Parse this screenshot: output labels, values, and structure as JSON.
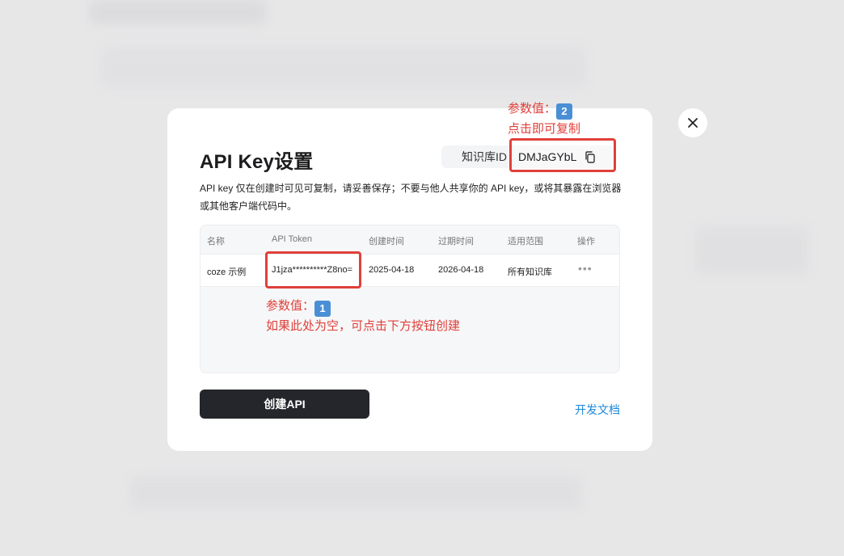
{
  "modal": {
    "title": "API Key设置",
    "knowledge_base": {
      "label": "知识库ID",
      "value": "DMJaGYbL"
    },
    "description": "API key 仅在创建时可见可复制，请妥善保存；不要与他人共享你的 API key，或将其暴露在浏览器或其他客户端代码中。",
    "table": {
      "headers": [
        "名称",
        "API Token",
        "创建时间",
        "过期时间",
        "适用范围",
        "操作"
      ],
      "rows": [
        {
          "name": "coze 示例",
          "token": "J1jza**********Z8no=",
          "created": "2025-04-18",
          "expires": "2026-04-18",
          "scope": "所有知识库",
          "actions": "•••"
        }
      ]
    },
    "create_button": "创建API",
    "docs_link": "开发文档"
  },
  "annotations": {
    "top": {
      "line1": "参数值：",
      "badge": "2",
      "line2": "点击即可复制"
    },
    "bottom": {
      "line1": "参数值：",
      "badge": "1",
      "line2": "如果此处为空，可点击下方按钮创建"
    }
  },
  "colors": {
    "annotation": "#e0403a",
    "link": "#1b87d8",
    "primary_button": "#24262b"
  }
}
